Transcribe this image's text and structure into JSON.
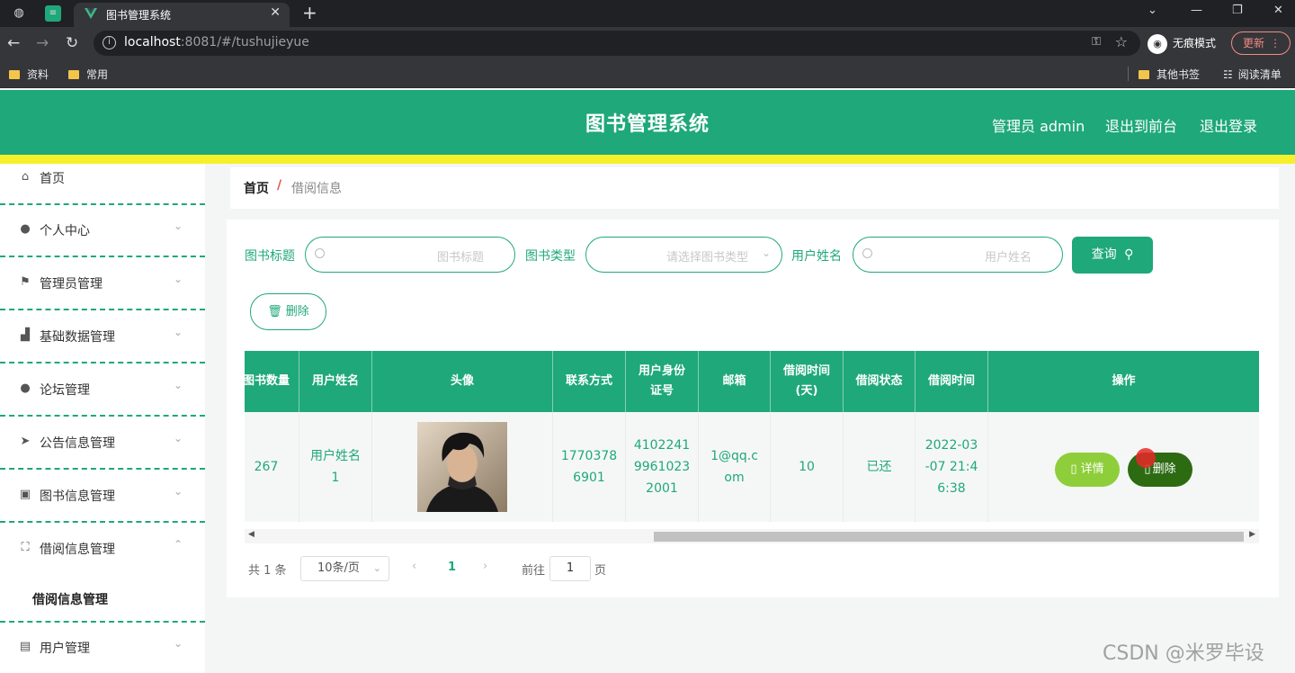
{
  "browser": {
    "tab_title": "图书管理系统",
    "url_host": "localhost",
    "url_rest": ":8081/#/tushujieyue",
    "incognito_label": "无痕模式",
    "update_label": "更新",
    "bookmarks": [
      "资料",
      "常用",
      "其他书签",
      "阅读清单"
    ]
  },
  "header": {
    "title": "图书管理系统",
    "admin_label": "管理员 admin",
    "back_front": "退出到前台",
    "logout": "退出登录"
  },
  "sidebar": {
    "items": [
      {
        "label": "首页",
        "icon": "home-icon"
      },
      {
        "label": "个人中心",
        "icon": "user-icon"
      },
      {
        "label": "管理员管理",
        "icon": "flag-icon"
      },
      {
        "label": "基础数据管理",
        "icon": "chart-icon"
      },
      {
        "label": "论坛管理",
        "icon": "user-icon"
      },
      {
        "label": "公告信息管理",
        "icon": "send-icon"
      },
      {
        "label": "图书信息管理",
        "icon": "briefcase-icon"
      },
      {
        "label": "借阅信息管理",
        "icon": "frame-icon"
      },
      {
        "label": "用户管理",
        "icon": "doc-icon"
      }
    ],
    "submenu_label": "借阅信息管理"
  },
  "breadcrumb": {
    "home": "首页",
    "separator": "/",
    "current": "借阅信息"
  },
  "search": {
    "title_label": "图书标题",
    "title_placeholder": "图书标题",
    "type_label": "图书类型",
    "type_placeholder": "请选择图书类型",
    "user_label": "用户姓名",
    "user_placeholder": "用户姓名",
    "query_button": "查询",
    "delete_button": "删除"
  },
  "table": {
    "headers": [
      "图书数量",
      "用户姓名",
      "头像",
      "联系方式",
      "用户身份\n证号",
      "邮箱",
      "借阅时间\n(天)",
      "借阅状态",
      "借阅时间",
      "操作"
    ],
    "row": {
      "count": "267",
      "user_name": "用户姓名\n1",
      "phone": "1770378\n6901",
      "id_card": "4102241\n9961023\n2001",
      "email": "1@qq.c\nom",
      "days": "10",
      "status": "已还",
      "borrow_time": "2022-03\n-07 21:4\n6:38",
      "detail_button": "详情",
      "delete_button": "删除"
    }
  },
  "pagination": {
    "total": "共 1 条",
    "page_size": "10条/页",
    "current_page": "1",
    "goto_label": "前往",
    "goto_value": "1",
    "page_suffix": "页"
  },
  "watermark": "CSDN @米罗毕设",
  "colors": {
    "primary": "#1fa87a",
    "accent_yellow": "#f5f02a",
    "detail_btn": "#8fce3b",
    "delete_btn": "#2c6b12"
  }
}
